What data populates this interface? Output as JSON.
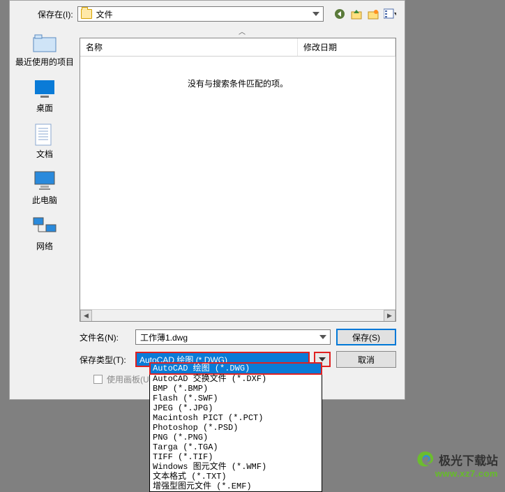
{
  "saveIn": {
    "label": "保存在(I):",
    "value": "文件"
  },
  "toolbarIcons": [
    "back-icon",
    "up-icon",
    "new-folder-icon",
    "views-icon"
  ],
  "sidebar": [
    {
      "label": "最近使用的项目",
      "icon": "recent"
    },
    {
      "label": "桌面",
      "icon": "desktop"
    },
    {
      "label": "文档",
      "icon": "documents"
    },
    {
      "label": "此电脑",
      "icon": "computer"
    },
    {
      "label": "网络",
      "icon": "network"
    }
  ],
  "columns": {
    "name": "名称",
    "date": "修改日期"
  },
  "emptyMessage": "没有与搜索条件匹配的项。",
  "filename": {
    "label": "文件名(N):",
    "value": "工作薄1.dwg"
  },
  "filetype": {
    "label": "保存类型(T):",
    "value": "AutoCAD 绘图 (*.DWG)"
  },
  "buttons": {
    "save": "保存(S)",
    "cancel": "取消"
  },
  "useArtboard": "使用画板(U)",
  "filetypeOptions": [
    "AutoCAD 绘图 (*.DWG)",
    "AutoCAD 交换文件 (*.DXF)",
    "BMP (*.BMP)",
    "Flash (*.SWF)",
    "JPEG (*.JPG)",
    "Macintosh PICT (*.PCT)",
    "Photoshop (*.PSD)",
    "PNG (*.PNG)",
    "Targa (*.TGA)",
    "TIFF (*.TIF)",
    "Windows 图元文件 (*.WMF)",
    "文本格式 (*.TXT)",
    "增强型图元文件 (*.EMF)"
  ],
  "selectedFiletypeIndex": 0,
  "watermark": {
    "text": "极光下载站",
    "url": "www.xz7.com"
  }
}
